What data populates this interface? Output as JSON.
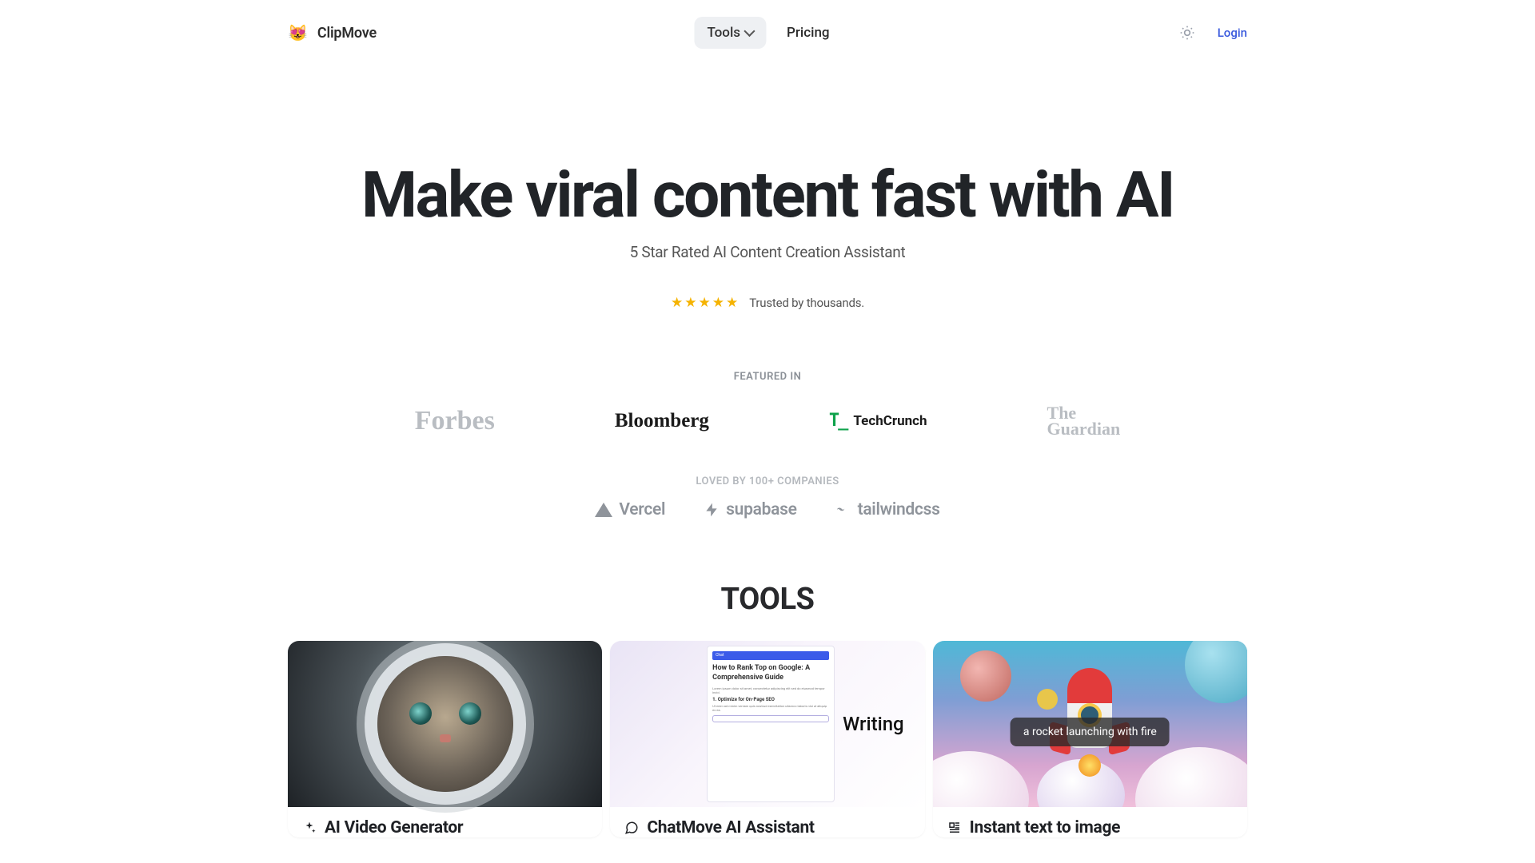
{
  "brand": {
    "icon": "😻",
    "name": "ClipMove"
  },
  "nav": {
    "tools": "Tools",
    "pricing": "Pricing"
  },
  "header": {
    "login": "Login"
  },
  "hero": {
    "headline": "Make viral content fast with AI",
    "subheadline": "5 Star Rated AI Content Creation Assistant",
    "trust_text": "Trusted by thousands."
  },
  "featured": {
    "label": "FEATURED IN",
    "logos": {
      "forbes": "Forbes",
      "bloomberg": "Bloomberg",
      "techcrunch_mark": "T_",
      "techcrunch": "TechCrunch",
      "guardian_line1": "The",
      "guardian_line2": "Guardian"
    }
  },
  "companies": {
    "label": "LOVED BY 100+ COMPANIES",
    "items": {
      "vercel": "Vercel",
      "supabase": "supabase",
      "tailwind": "tailwindcss"
    }
  },
  "tools_section": {
    "heading": "TOOLS",
    "cards": [
      {
        "title": "AI Video Generator"
      },
      {
        "title": "ChatMove AI Assistant",
        "panel_tag": "Chat",
        "panel_headline": "How to Rank Top on Google: A Comprehensive Guide",
        "panel_sub": "1. Optimize for On-Page SEO",
        "side_label": "Writing"
      },
      {
        "title": "Instant text to image",
        "prompt": "a rocket launching with fire"
      }
    ]
  }
}
